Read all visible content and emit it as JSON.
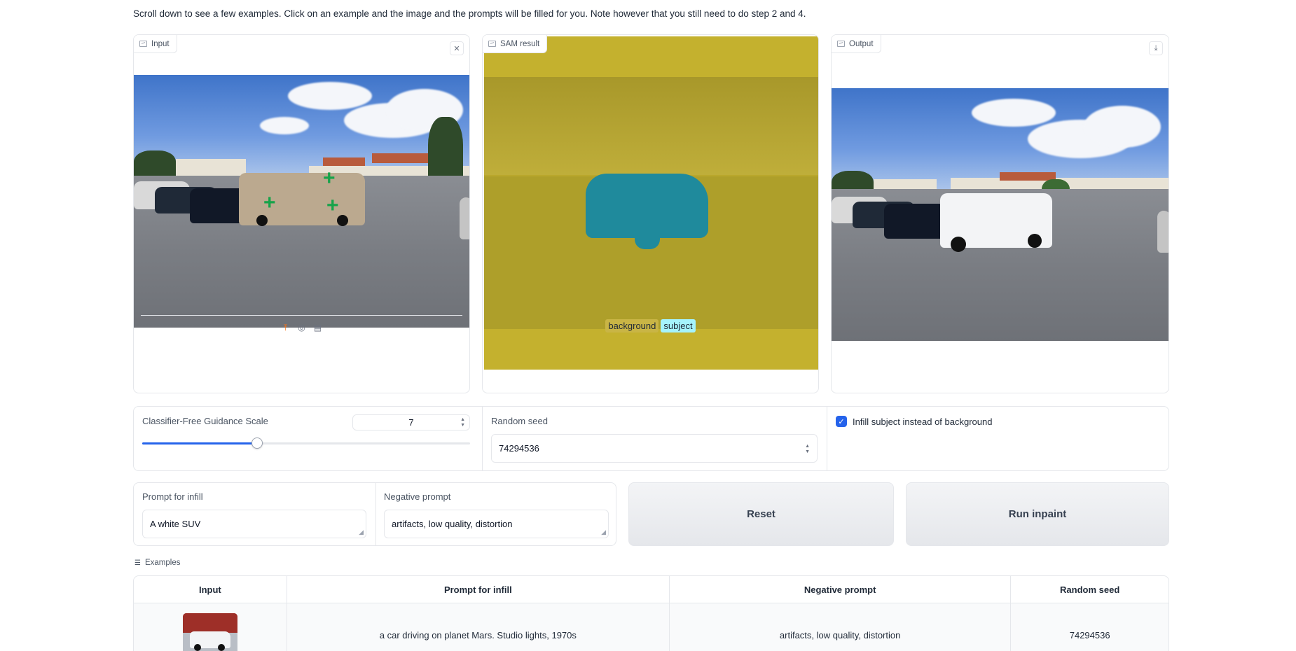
{
  "intro_text": "Scroll down to see a few examples. Click on an example and the image and the prompts will be filled for you. Note however that you still need to do step 2 and 4.",
  "panels": {
    "input_label": "Input",
    "sam_label": "SAM result",
    "output_label": "Output"
  },
  "sam_legend": [
    {
      "label": "background",
      "color": "#c9b545"
    },
    {
      "label": "subject",
      "color": "#a5f3fc"
    }
  ],
  "controls": {
    "cfg_label": "Classifier-Free Guidance Scale",
    "cfg_value": "7",
    "cfg_fraction": 0.35,
    "seed_label": "Random seed",
    "seed_value": "74294536",
    "infill_checkbox_label": "Infill subject instead of background",
    "infill_checked": true
  },
  "prompts": {
    "infill_label": "Prompt for infill",
    "infill_value": "A white SUV",
    "negative_label": "Negative prompt",
    "negative_value": "artifacts, low quality, distortion"
  },
  "buttons": {
    "reset": "Reset",
    "run": "Run inpaint"
  },
  "examples": {
    "label": "Examples",
    "headers": [
      "Input",
      "Prompt for infill",
      "Negative prompt",
      "Random seed"
    ],
    "row": {
      "prompt": "a car driving on planet Mars. Studio lights, 1970s",
      "negative": "artifacts, low quality, distortion",
      "seed": "74294536"
    }
  },
  "colors": {
    "accent": "#2563eb",
    "sam_mask": "#c4b12e",
    "subject_mask": "#1f8a9c"
  }
}
